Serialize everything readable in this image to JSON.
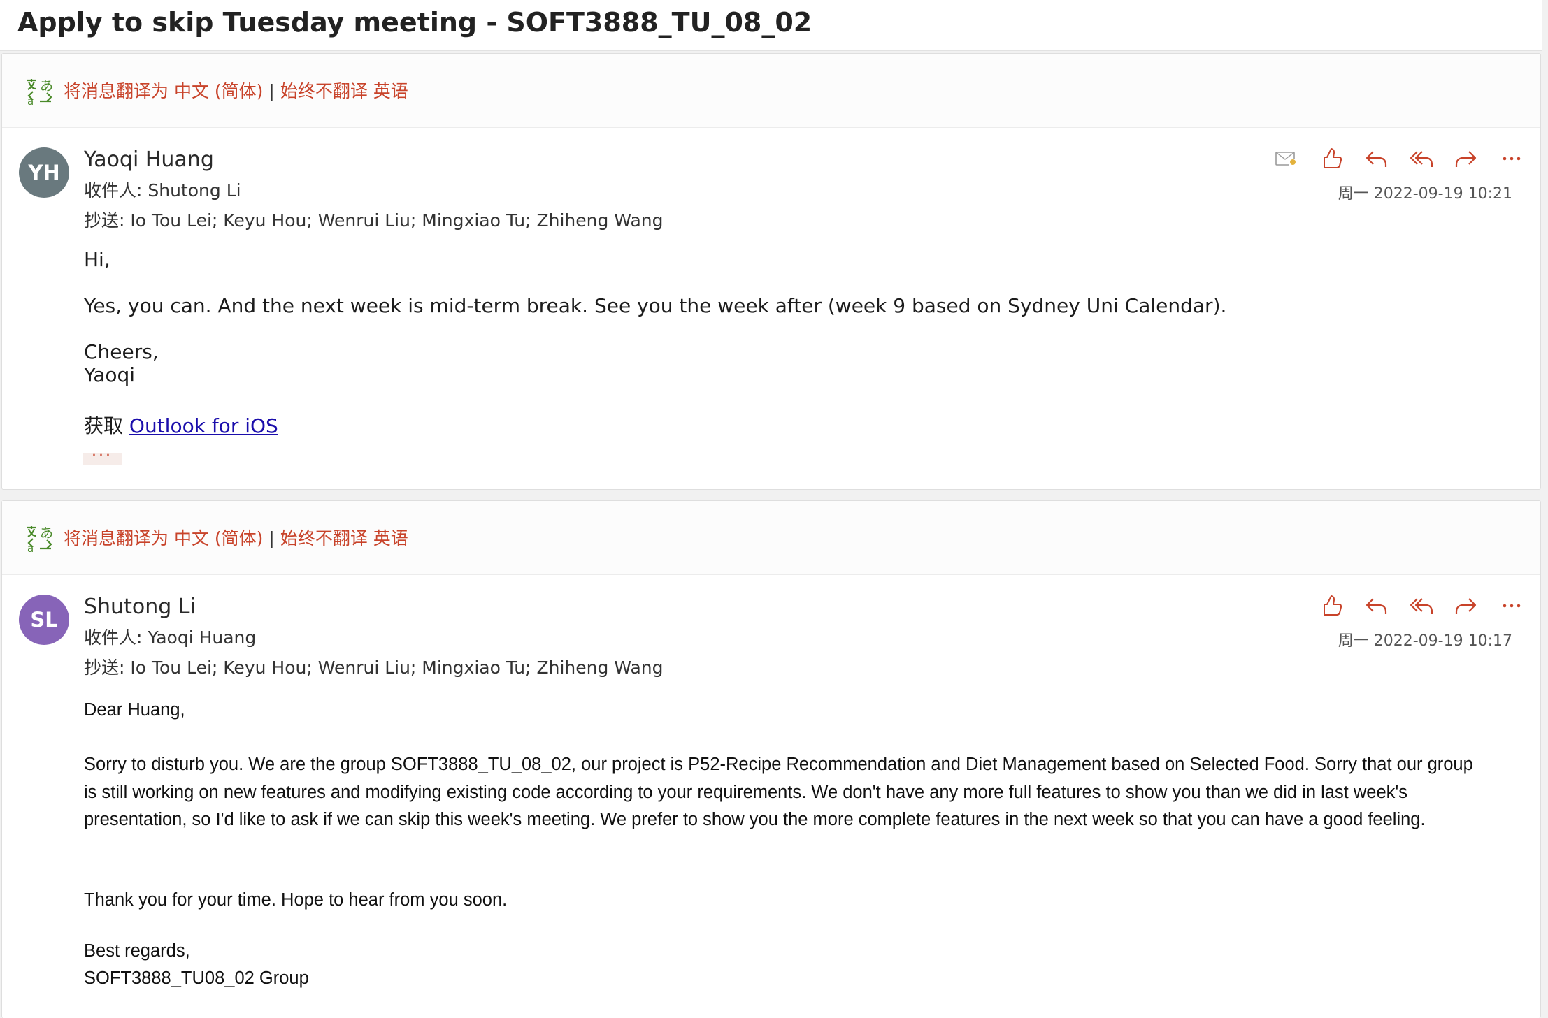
{
  "subject": "Apply to skip Tuesday meeting - SOFT3888_TU_08_02",
  "translate_bar": {
    "translate_label": "将消息翻译为 中文 (简体)",
    "separator": "|",
    "never_label": "始终不翻译 英语"
  },
  "icons": [
    "translate-icon",
    "mail-flag-icon",
    "like-icon",
    "reply-icon",
    "reply-all-icon",
    "forward-icon",
    "more-icon"
  ],
  "colors": {
    "accent": "#c8432a",
    "avatar_yh": "#69797e",
    "avatar_sl": "#8764b8",
    "link": "#1a0dab"
  },
  "messages": [
    {
      "avatar_initials": "YH",
      "sender": "Yaoqi Huang",
      "to_label": "收件人: ",
      "to": "Shutong Li",
      "cc_label": "抄送: ",
      "cc": "Io Tou Lei;  Keyu Hou;  Wenrui Liu;  Mingxiao Tu;  Zhiheng Wang",
      "date": "周一 2022-09-19 10:21",
      "body": {
        "greeting": "Hi,",
        "para1": "Yes, you can. And the next week is mid-term break. See you the week after (week 9 based on Sydney Uni Calendar).",
        "closing": "Cheers,",
        "signature": "Yaoqi",
        "get_prefix": "获取 ",
        "get_link": "Outlook for iOS",
        "more": "···"
      }
    },
    {
      "avatar_initials": "SL",
      "sender": "Shutong Li",
      "to_label": "收件人: ",
      "to": "Yaoqi Huang",
      "cc_label": "抄送: ",
      "cc": "Io Tou Lei;  Keyu Hou;  Wenrui Liu;  Mingxiao Tu;  Zhiheng Wang",
      "date": "周一 2022-09-19 10:17",
      "body": {
        "greeting": "Dear Huang,",
        "para1": "Sorry to disturb you. We are the group SOFT3888_TU_08_02, our project is P52-Recipe Recommendation and Diet Management based on Selected Food. Sorry that our group is still working on new features and modifying existing code according to your requirements. We don't have any more full features to show you than we did in last week's presentation, so I'd like to ask if we can skip this week's meeting. We prefer to show you the more complete features in the next week so that you can have a good feeling.",
        "para2": "Thank you for your time. Hope to hear from you soon.",
        "closing": "Best regards,",
        "signature": "SOFT3888_TU08_02 Group"
      }
    }
  ]
}
